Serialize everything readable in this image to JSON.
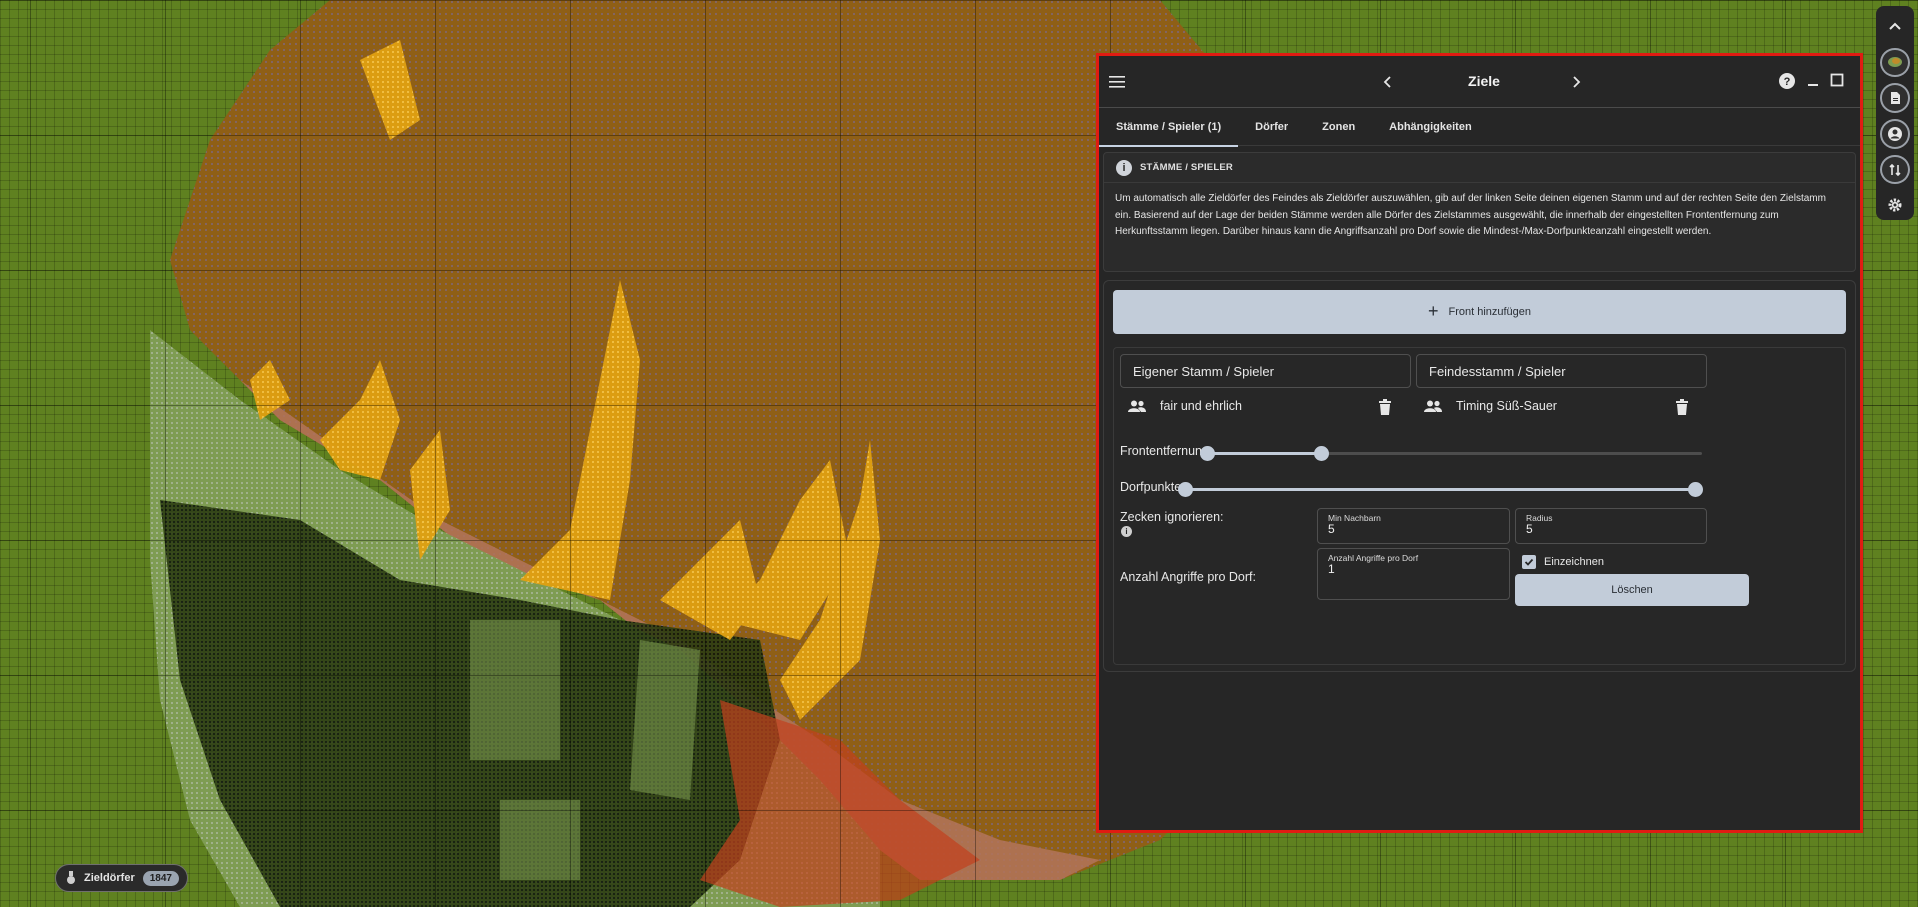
{
  "panel": {
    "title": "Ziele",
    "tabs": [
      {
        "label": "Stämme / Spieler (1)"
      },
      {
        "label": "Dörfer"
      },
      {
        "label": "Zonen"
      },
      {
        "label": "Abhängigkeiten"
      }
    ],
    "info": {
      "heading": "STÄMME / SPIELER",
      "text": "Um automatisch alle Zieldörfer des Feindes als Zieldörfer auszuwählen, gib auf der linken Seite deinen eigenen Stamm und auf der rechten Seite den Zielstamm ein. Basierend auf der Lage der beiden Stämme werden alle Dörfer des Zielstammes ausgewählt, die innerhalb der eingestellten Frontentfernung zum Herkunftsstamm liegen. Darüber hinaus kann die Angriffsanzahl pro Dorf sowie die Mindest-/Max-Dorfpunkteanzahl eingestellt werden."
    },
    "front": {
      "add_button": "Front hinzufügen",
      "own_tribe_label": "Eigener Stamm / Spieler",
      "enemy_tribe_label": "Feindesstamm / Spieler",
      "own_tribe": "fair und ehrlich",
      "enemy_tribe": "Timing Süß-Sauer",
      "front_distance_label": "Frontentfernung",
      "front_distance_range": [
        0,
        0.23
      ],
      "village_points_label": "Dorfpunkte",
      "village_points_range": [
        0,
        1
      ],
      "ignore_ticks_label": "Zecken ignorieren:",
      "min_neighbors_label": "Min Nachbarn",
      "min_neighbors_value": "5",
      "radius_label": "Radius",
      "radius_value": "5",
      "attacks_label": "Anzahl Angriffe pro Dorf:",
      "attacks_field_label": "Anzahl Angriffe pro Dorf",
      "attacks_value": "1",
      "draw_label": "Einzeichnen",
      "draw_checked": true,
      "delete_button": "Löschen"
    }
  },
  "status_chip": {
    "label": "Zieldörfer",
    "count": "1847"
  },
  "toolbar": {
    "icons": [
      "chevron-up-icon",
      "map-icon",
      "document-icon",
      "account-icon",
      "swap-icon",
      "gear-icon"
    ]
  },
  "colors": {
    "panel_bg": "#262626",
    "panel_border": "#e01b12",
    "accent": "#c2ccd9",
    "map_grass": "#5f8120",
    "map_tribe_brown": "#8f5f16",
    "map_tribe_yellow": "#e8a41a",
    "map_tribe_green": "#7e9c52",
    "map_tribe_red": "#c2401c"
  }
}
